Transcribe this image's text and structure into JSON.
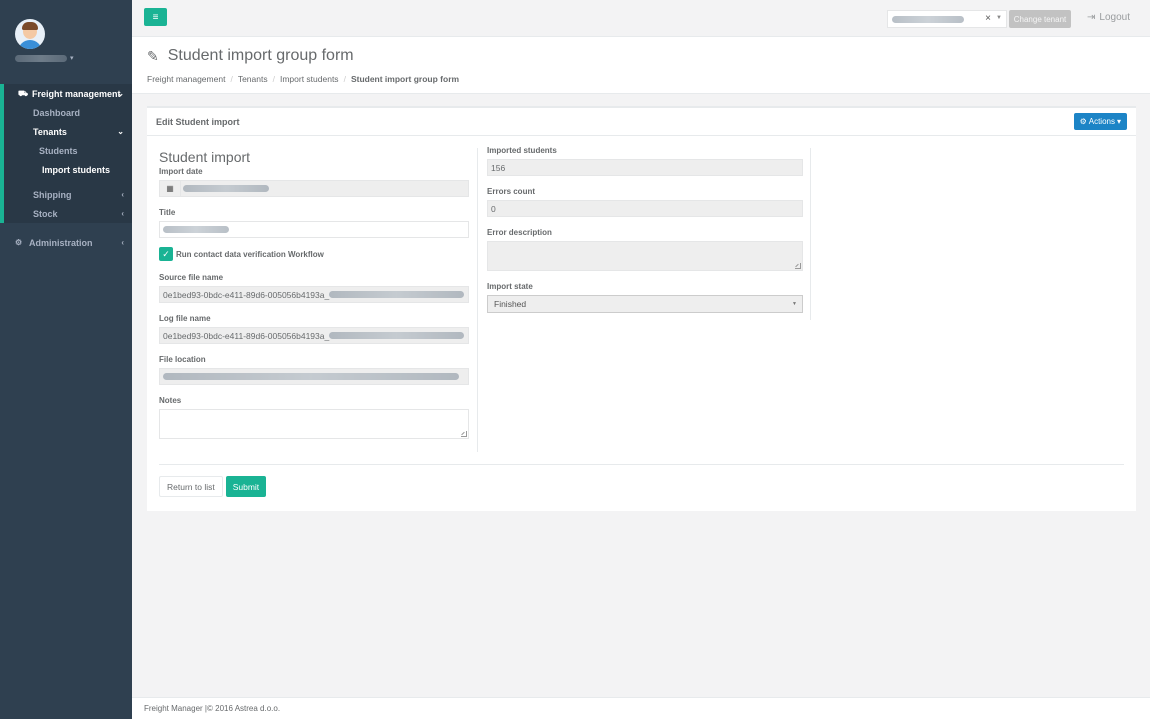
{
  "sidebar": {
    "user_name_redacted": "user",
    "items": [
      {
        "label": "Freight management",
        "icon": "truck-icon"
      },
      {
        "label": "Dashboard"
      },
      {
        "label": "Tenants"
      },
      {
        "label": "Students"
      },
      {
        "label": "Import students"
      },
      {
        "label": "Shipping"
      },
      {
        "label": "Stock"
      },
      {
        "label": "Administration",
        "icon": "gear-icon"
      }
    ]
  },
  "topbar": {
    "menu_icon": "hamburger-icon",
    "tenant_clear": "×",
    "change_tenant_label": "Change tenant",
    "logout_label": "Logout"
  },
  "heading": {
    "title": "Student import group form",
    "breadcrumb": [
      "Freight management",
      "Tenants",
      "Import students",
      "Student import group form"
    ]
  },
  "panel": {
    "title": "Edit Student import",
    "actions_label": "Actions"
  },
  "form": {
    "section_title": "Student import",
    "import_date_label": "Import date",
    "title_label": "Title",
    "workflow_checkbox_label": "Run contact data verification Workflow",
    "source_file_label": "Source file name",
    "source_file_value": "0e1bed93-0bdc-e411-89d6-005056b4193a_",
    "log_file_label": "Log file name",
    "log_file_value": "0e1bed93-0bdc-e411-89d6-005056b4193a_",
    "file_location_label": "File location",
    "notes_label": "Notes",
    "imported_students_label": "Imported students",
    "imported_students_value": "156",
    "errors_count_label": "Errors count",
    "errors_count_value": "0",
    "error_description_label": "Error description",
    "import_state_label": "Import state",
    "import_state_value": "Finished",
    "return_button": "Return to list",
    "submit_button": "Submit"
  },
  "footer": {
    "text": "Freight Manager |© 2016 Astrea d.o.o."
  }
}
